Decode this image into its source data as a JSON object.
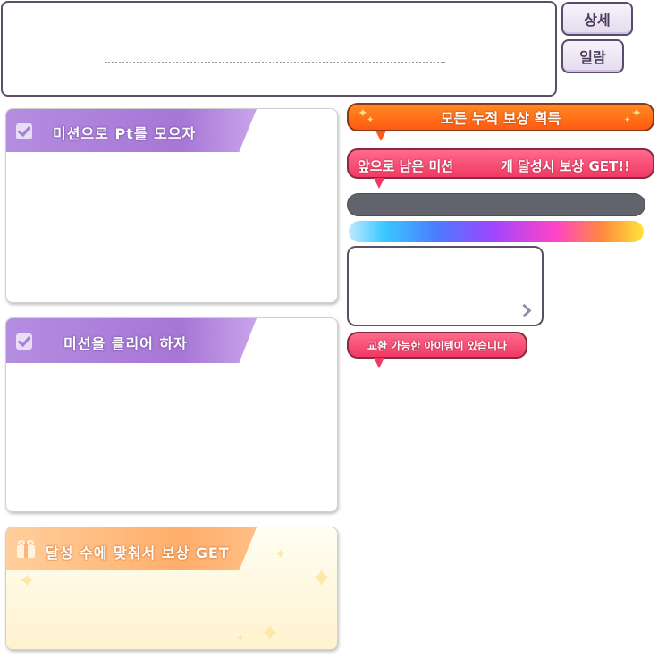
{
  "top_panel": {
    "description_text": ""
  },
  "buttons": {
    "detail": "상세",
    "list": "일람"
  },
  "mission_panels": [
    {
      "title": "미션으로 Pt를 모으자",
      "icon": "checkbox-icon"
    },
    {
      "title": "미션을 클리어 하자",
      "icon": "checkbox-icon"
    },
    {
      "title": "달성 수에 맞춰서 보상 GET",
      "icon": "gift-icon"
    }
  ],
  "banners": {
    "total_reward": "모든 누적 보상 획득",
    "remaining_left": "앞으로 남은 미션",
    "remaining_right": "개 달성시 보상 GET!!",
    "exchange": "교환 가능한 아이템이 있습니다"
  },
  "colors": {
    "panel_header_purple": "#a776d6",
    "panel_header_orange": "#ffae6a",
    "banner_orange": "#ff5a10",
    "banner_pink": "#f03a64",
    "gauge_gray": "#62636c"
  }
}
